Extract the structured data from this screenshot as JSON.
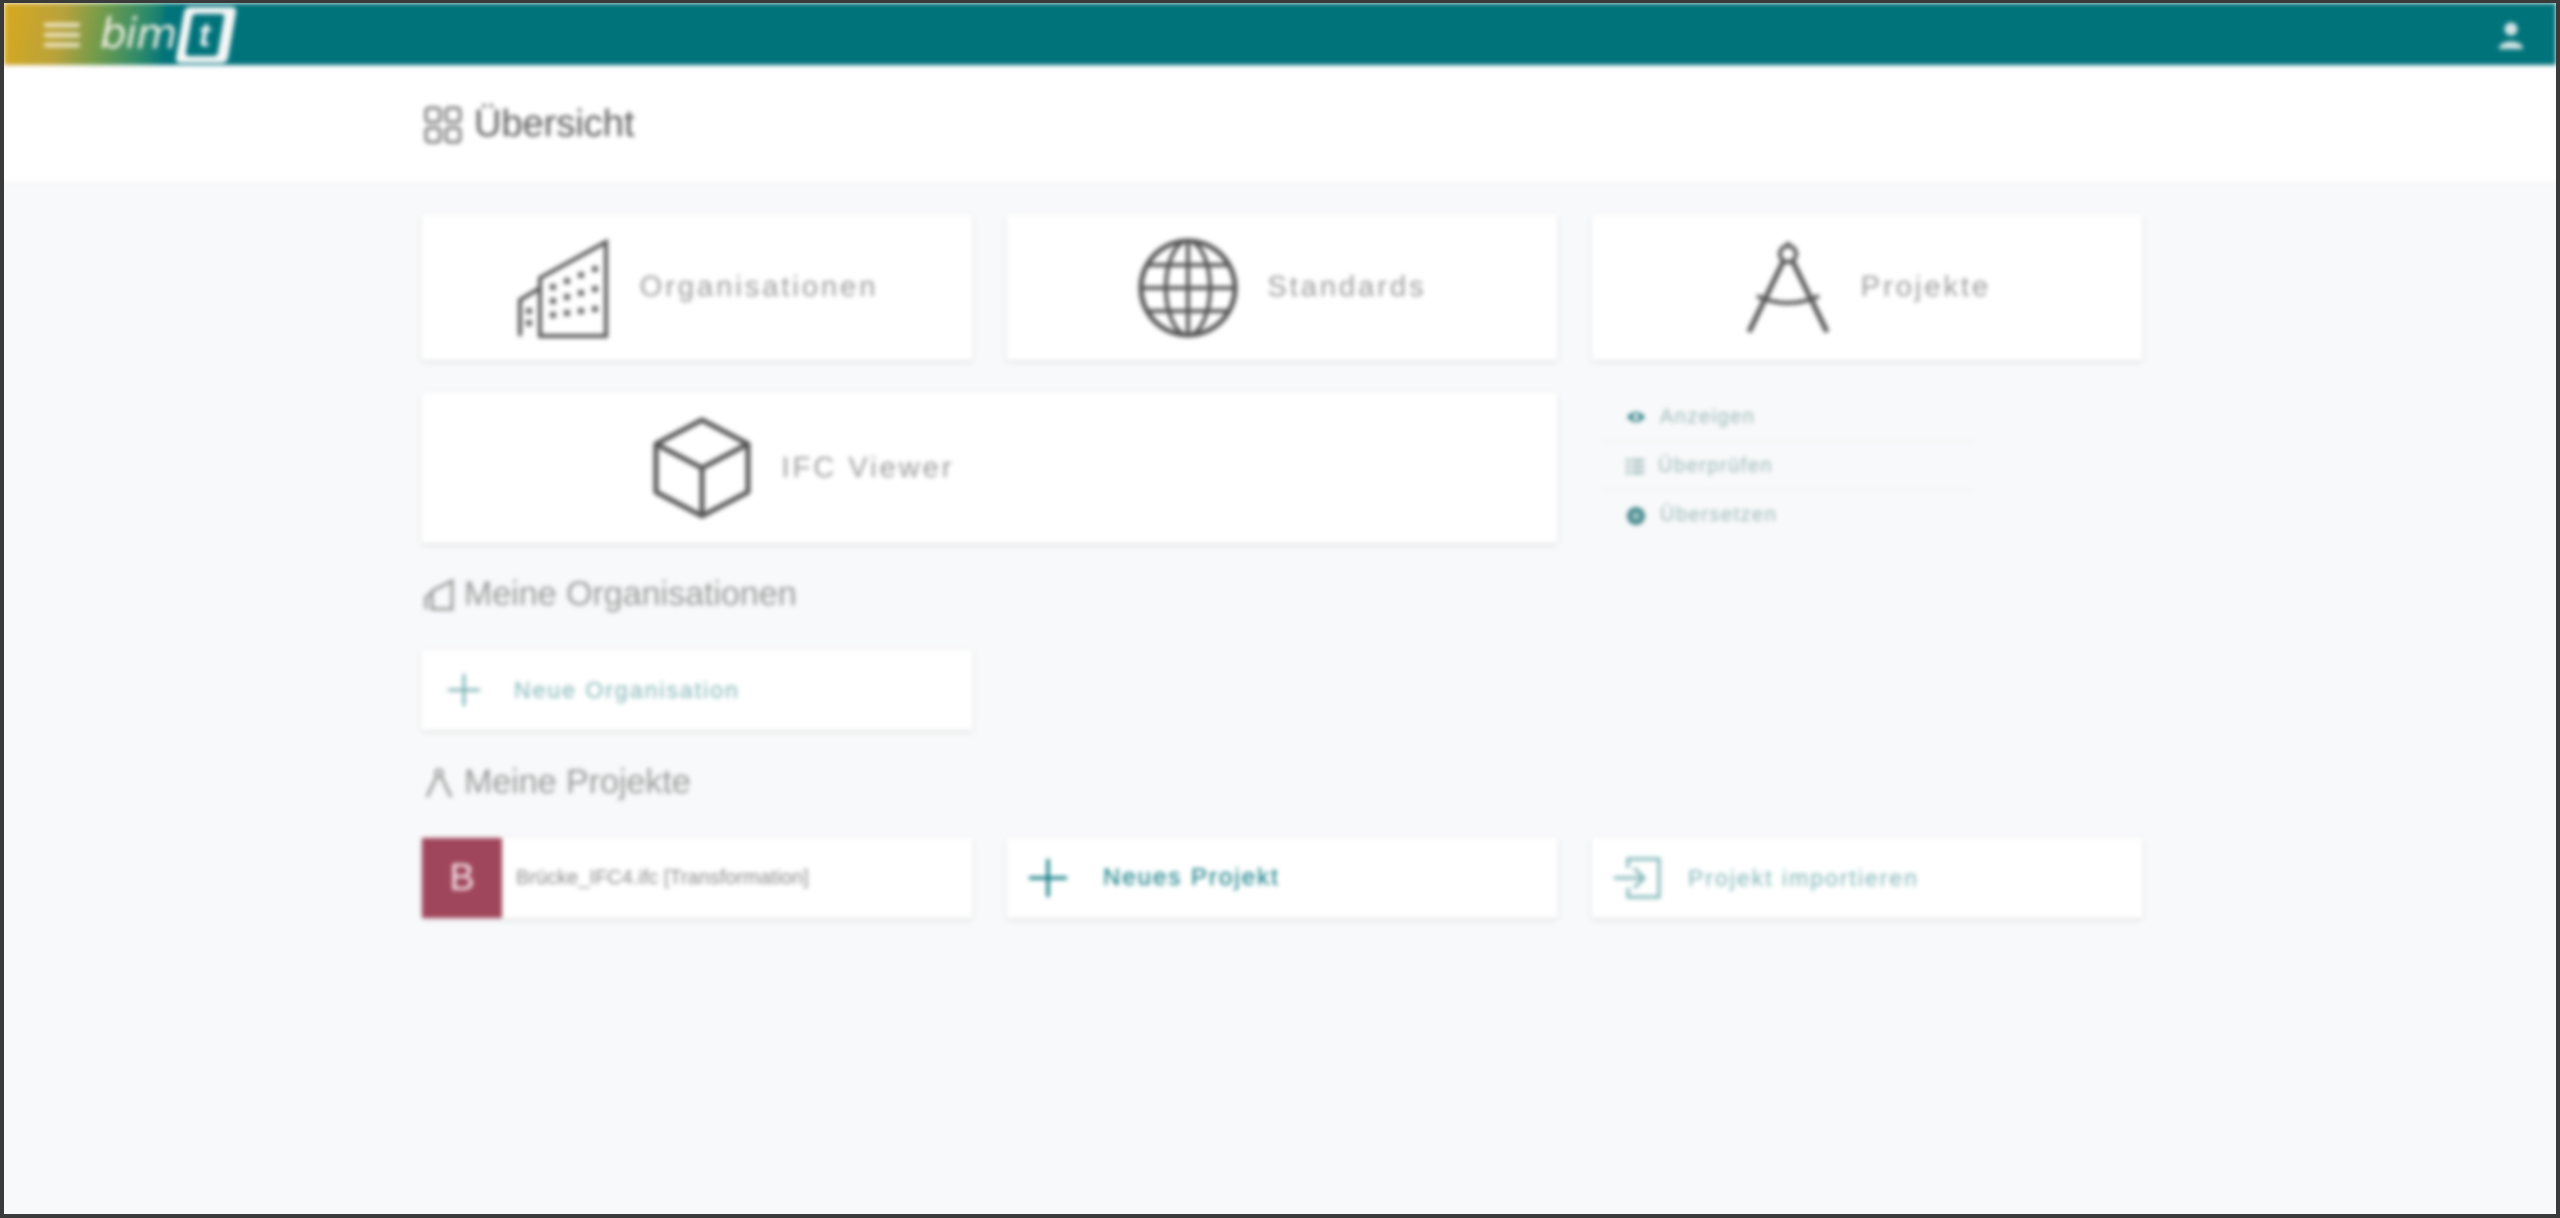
{
  "topbar": {
    "logo_text": "bim",
    "logo_badge": "t"
  },
  "header": {
    "title": "Übersicht"
  },
  "tiles": {
    "organisations": "Organisationen",
    "standards": "Standards",
    "projects": "Projekte",
    "ifc_viewer": "IFC Viewer"
  },
  "ifc_viewer_links": {
    "view": "Anzeigen",
    "check": "Überprüfen",
    "translate": "Übersetzen"
  },
  "my_organisations": {
    "title": "Meine Organisationen",
    "new_label": "Neue Organisation"
  },
  "my_projects": {
    "title": "Meine Projekte",
    "project_initial": "B",
    "project_name": "Brücke_IFC4.ifc [Transformation]",
    "new_label": "Neues Projekt",
    "import_label": "Projekt importieren"
  },
  "colors": {
    "accent": "#00737a",
    "project_avatar": "#a0465c",
    "background": "#f8f9fa"
  }
}
